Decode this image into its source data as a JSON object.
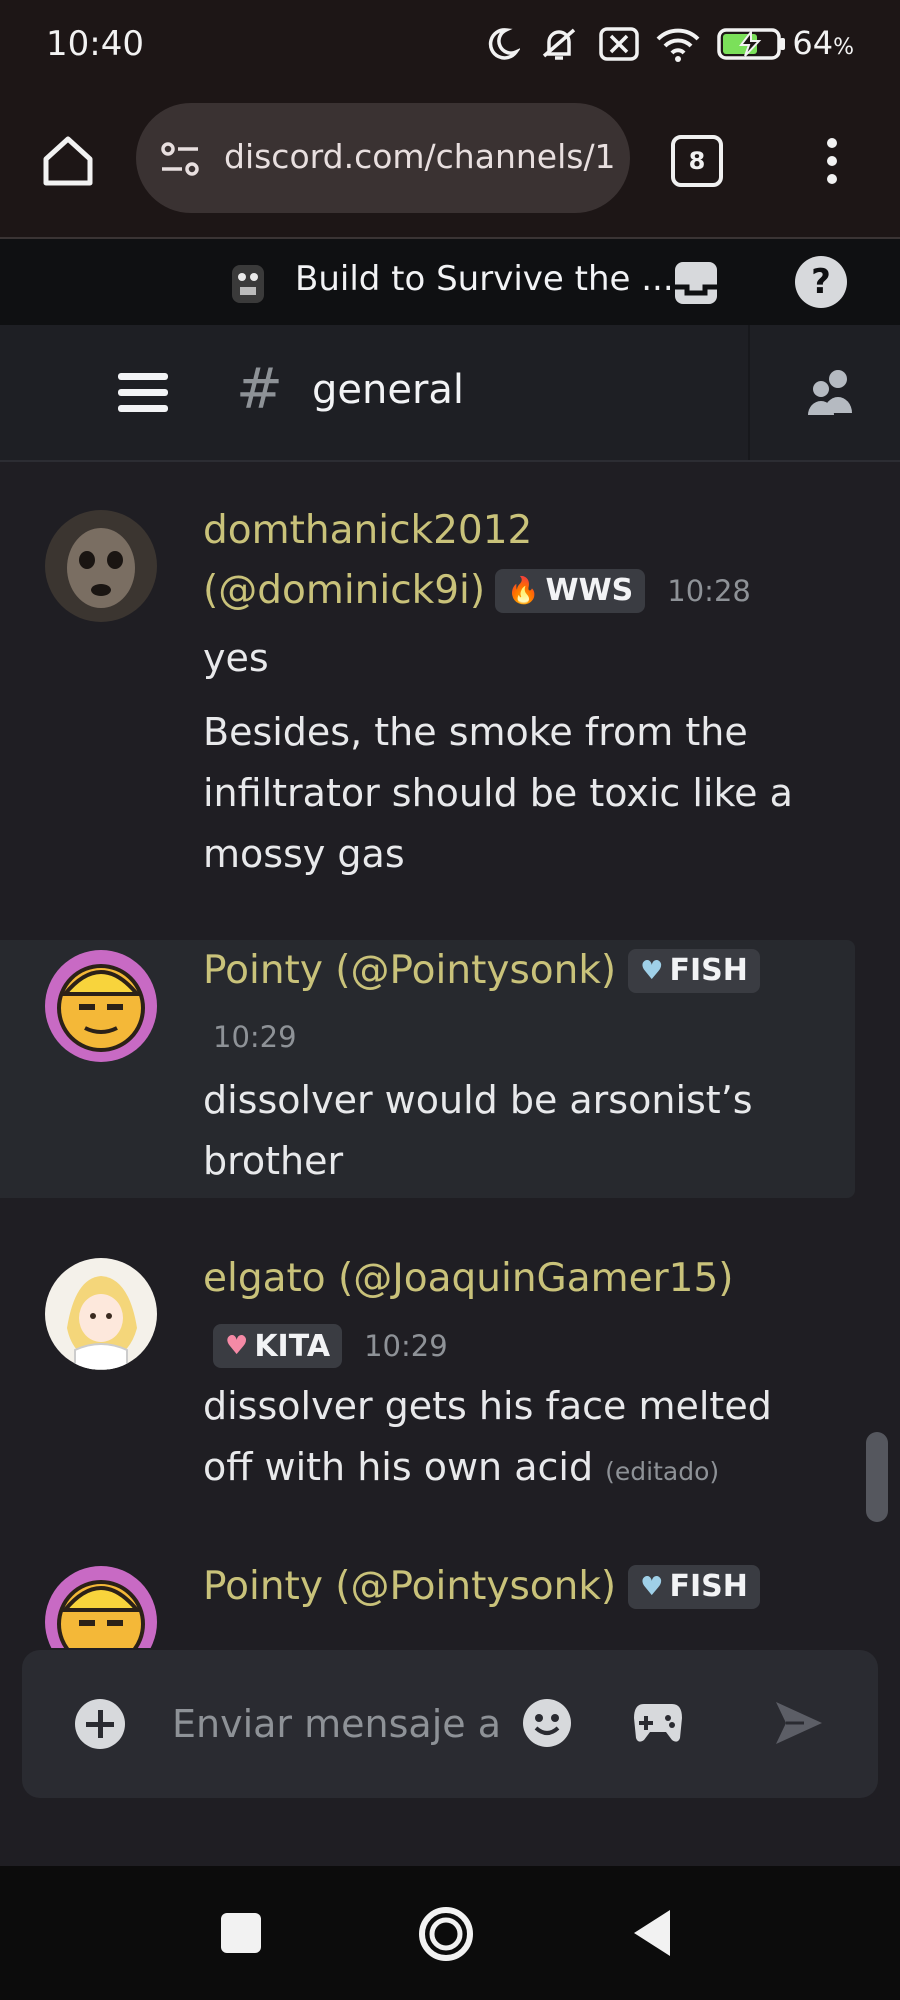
{
  "status": {
    "time": "10:40",
    "battery_percent": "64",
    "battery_unit": "%",
    "icons": [
      "moon-icon",
      "muted-bell-icon",
      "no-sim-icon",
      "wifi-icon",
      "battery-charging-icon"
    ]
  },
  "browser": {
    "url": "discord.com/channels/1",
    "tab_count": "8"
  },
  "server": {
    "name": "Build to Survive the ..."
  },
  "channel": {
    "name": "general"
  },
  "messages": [
    {
      "display_name": "domthanick2012",
      "handle": "(@dominick9i)",
      "badge": "WWS",
      "time": "10:28",
      "lines": [
        "yes",
        "Besides, the smoke from the infiltrator should be toxic like a mossy gas"
      ]
    },
    {
      "author": "Pointy (@Pointysonk)",
      "badge": "FISH",
      "time": "10:29",
      "lines": [
        "dissolver would be arsonist’s brother"
      ]
    },
    {
      "author": "elgato (@JoaquinGamer15)",
      "badge": "KITA",
      "time": "10:29",
      "text": "dissolver gets his face melted off with his own acid",
      "edited": "(editado)"
    },
    {
      "author": "Pointy (@Pointysonk)",
      "badge": "FISH"
    }
  ],
  "composer": {
    "placeholder": "Enviar mensaje a"
  },
  "colors": {
    "background": "#1f1e23",
    "author_name": "#c9c27a",
    "send_disabled": "#5c5e66"
  }
}
